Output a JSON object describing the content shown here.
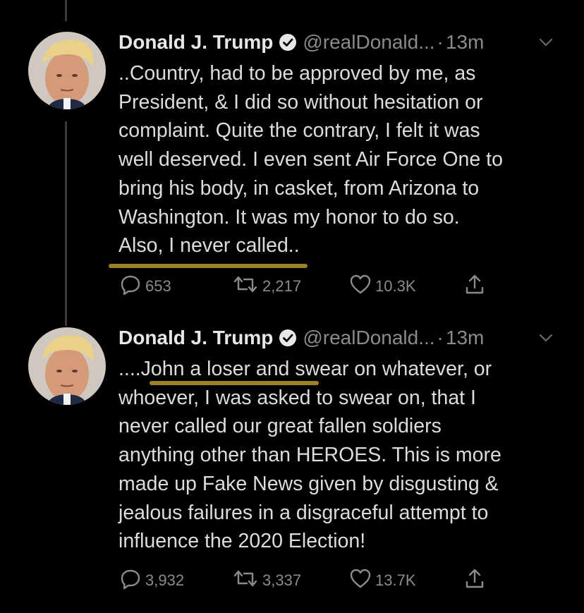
{
  "tweets": [
    {
      "author_name": "Donald J. Trump",
      "handle": "@realDonald...",
      "separator": "·",
      "time": "13m",
      "text": "..Country, had to be approved by me, as\nPresident, & I did so without hesitation  or\ncomplaint. Quite the contrary, I felt it was\nwell deserved. I even sent Air Force One to\nbring his body, in casket, from Arizona to\nWashington. It was my honor to do so.\nAlso, I never called..",
      "replies": "653",
      "retweets": "2,217",
      "likes": "10.3K"
    },
    {
      "author_name": "Donald J. Trump",
      "handle": "@realDonald...",
      "separator": "·",
      "time": "13m",
      "text": "....John a loser and swear on whatever, or\nwhoever, I was asked to swear on, that I\nnever called our great fallen soldiers\nanything other than HEROES. This is more\nmade up Fake News given by disgusting &\njealous failures in a disgraceful attempt to\ninfluence the 2020 Election!",
      "replies": "3,932",
      "retweets": "3,337",
      "likes": "13.7K"
    }
  ],
  "icons": {
    "verified": "verified-badge-icon",
    "caret": "chevron-down-icon",
    "reply": "reply-icon",
    "retweet": "retweet-icon",
    "like": "heart-icon",
    "share": "share-icon"
  },
  "colors": {
    "background": "#000000",
    "name": "#e7e7e7",
    "secondary": "#8b8b8b",
    "highlight": "#9c8426"
  }
}
